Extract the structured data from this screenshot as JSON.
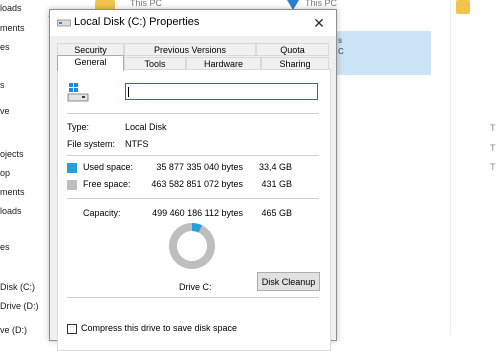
{
  "background": {
    "nav_items": [
      "loads",
      "ments",
      "es",
      "s",
      "ve",
      "ojects",
      "op",
      "ments",
      "loads",
      "es",
      "Disk (C:)",
      "Drive (D:)",
      "ve (D:)"
    ],
    "this_pc_label": "This PC",
    "selected_item_lines": [
      "s",
      "C"
    ],
    "right_column_letters": [
      "T",
      "T",
      "T"
    ],
    "pin_icon": "pin-icon"
  },
  "dialog": {
    "title": "Local Disk (C:) Properties",
    "close_glyph": "✕",
    "tabs_back": [
      "Security",
      "Previous Versions",
      "Quota"
    ],
    "tabs_front": [
      "General",
      "Tools",
      "Hardware",
      "Sharing"
    ],
    "active_tab": "General",
    "name_field_value": "",
    "type_label": "Type:",
    "type_value": "Local Disk",
    "fs_label": "File system:",
    "fs_value": "NTFS",
    "used": {
      "label": "Used space:",
      "bytes": "35 877 335 040 bytes",
      "size": "33,4 GB",
      "color": "#26a0da"
    },
    "free": {
      "label": "Free space:",
      "bytes": "463 582 851 072 bytes",
      "size": "431 GB",
      "color": "#bebebe"
    },
    "capacity": {
      "label": "Capacity:",
      "bytes": "499 460 186 112 bytes",
      "size": "465 GB"
    },
    "used_fraction": 0.0718,
    "drive_label": "Drive C:",
    "cleanup_button": "Disk Cleanup",
    "compress_label": "Compress this drive to save disk space",
    "compress_checked": false
  }
}
